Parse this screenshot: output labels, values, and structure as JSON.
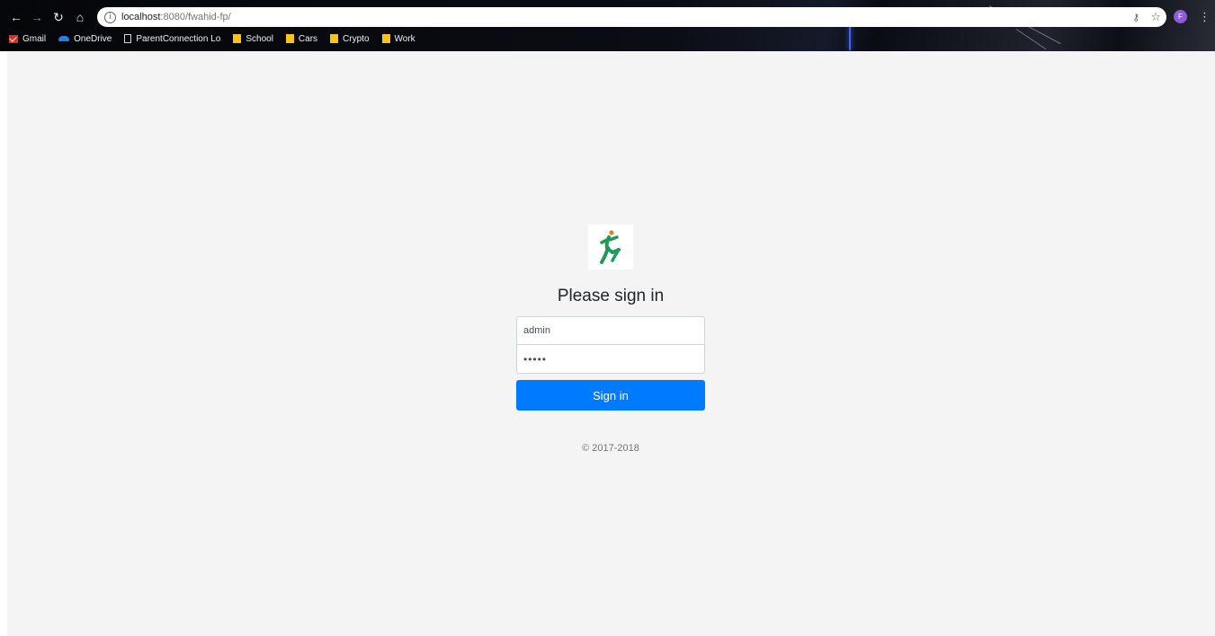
{
  "browser": {
    "nav_icons": {
      "back": "arrow-left-icon",
      "forward": "arrow-right-icon",
      "reload": "reload-icon",
      "home": "home-icon"
    },
    "address_bar": {
      "host": "localhost",
      "rest": ":8080/fwahid-fp/"
    },
    "profile_initial": "F",
    "bookmarks": [
      {
        "label": "Gmail",
        "icon": "gmail-icon"
      },
      {
        "label": "OneDrive",
        "icon": "onedrive-icon"
      },
      {
        "label": "ParentConnection Lo",
        "icon": "page-icon"
      },
      {
        "label": "School",
        "icon": "folder-icon"
      },
      {
        "label": "Cars",
        "icon": "folder-icon"
      },
      {
        "label": "Crypto",
        "icon": "folder-icon"
      },
      {
        "label": "Work",
        "icon": "folder-icon"
      }
    ]
  },
  "login": {
    "heading": "Please sign in",
    "username_value": "admin",
    "password_value": "•••••",
    "signin_label": "Sign in",
    "copyright": "© 2017-2018"
  },
  "colors": {
    "accent": "#007bff",
    "page_background": "#f4f4f4",
    "logo_green": "#1f9a5a",
    "logo_orange": "#d9822b"
  }
}
